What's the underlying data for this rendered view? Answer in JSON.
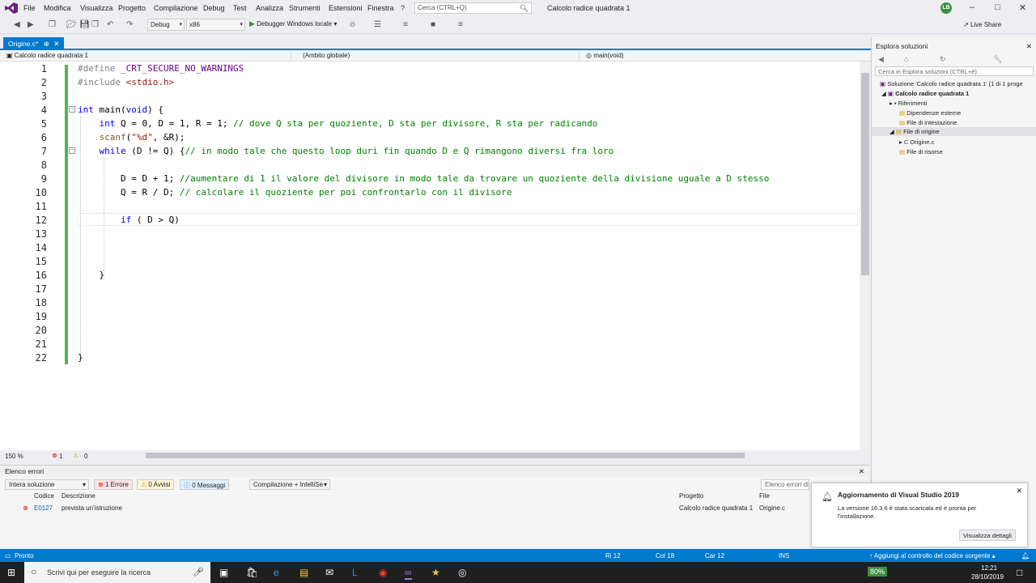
{
  "menu": {
    "items": [
      "File",
      "Modifica",
      "Visualizza",
      "Progetto",
      "Compilazione",
      "Debug",
      "Test",
      "Analizza",
      "Strumenti",
      "Estensioni",
      "Finestra",
      "?"
    ],
    "search_placeholder": "Cerca (CTRL+Q)",
    "window_title": "Calcolo radice quadrata 1",
    "avatar": "LB"
  },
  "toolbar": {
    "config": "Debug",
    "platform": "x86",
    "run_label": "Debugger Windows locale",
    "live_share": "Live Share"
  },
  "tab": {
    "label": "Origine.c*"
  },
  "nav": {
    "project": "Calcolo radice quadrata 1",
    "scope": "(Ambito globale)",
    "member": "main(void)"
  },
  "editor": {
    "line_numbers": [
      "1",
      "2",
      "3",
      "4",
      "5",
      "6",
      "7",
      "8",
      "9",
      "10",
      "11",
      "12",
      "13",
      "14",
      "15",
      "16",
      "17",
      "18",
      "19",
      "20",
      "21",
      "22"
    ],
    "zoom": "150 %",
    "errors_count": "1",
    "warnings_count": "0"
  },
  "solution_explorer": {
    "title": "Esplora soluzioni",
    "search_placeholder": "Cerca in Esplora soluzioni (CTRL+è)",
    "items": [
      "Soluzione 'Calcolo radice quadrata 1' (1 di 1 proge",
      "Calcolo radice quadrata 1",
      "Riferimenti",
      "Dipendenze esterne",
      "File di intestazione",
      "File di origine",
      "Origine.c",
      "File di risorse"
    ]
  },
  "error_list": {
    "title": "Elenco errori",
    "scope": "Intera soluzione",
    "errors_btn": "1 Errore",
    "warnings_btn": "0 Avvisi",
    "messages_btn": "0 Messaggi",
    "build_filter": "Compilazione + IntelliSe",
    "search_placeholder": "Elenco errori di",
    "headers": [
      "Codice",
      "Descrizione",
      "Progetto",
      "File"
    ],
    "rows": [
      {
        "code": "E0127",
        "description": "prevista un'istruzione",
        "project": "Calcolo radice quadrata 1",
        "file": "Origine.c"
      }
    ]
  },
  "notification": {
    "title": "Aggiornamento di Visual Studio 2019",
    "body_line1": "La versione 16.3.6 è stata scaricata ed è pronta per",
    "body_line2": "l'installazione.",
    "button": "Visualizza dettagli"
  },
  "status": {
    "ready": "Pronto",
    "row": "Ri 12",
    "col": "Col 18",
    "char": "Car 12",
    "mode": "INS",
    "source_control": "Aggiungi al controllo del codice sorgente"
  },
  "taskbar": {
    "search": "Scrivi qui per eseguire la ricerca",
    "battery": "80%",
    "time": "12:21",
    "date": "28/10/2019"
  },
  "colors": {
    "accent": "#007acc",
    "keyword": "#0000ff",
    "comment": "#008000",
    "string": "#a31515",
    "macro": "#6f008a"
  }
}
